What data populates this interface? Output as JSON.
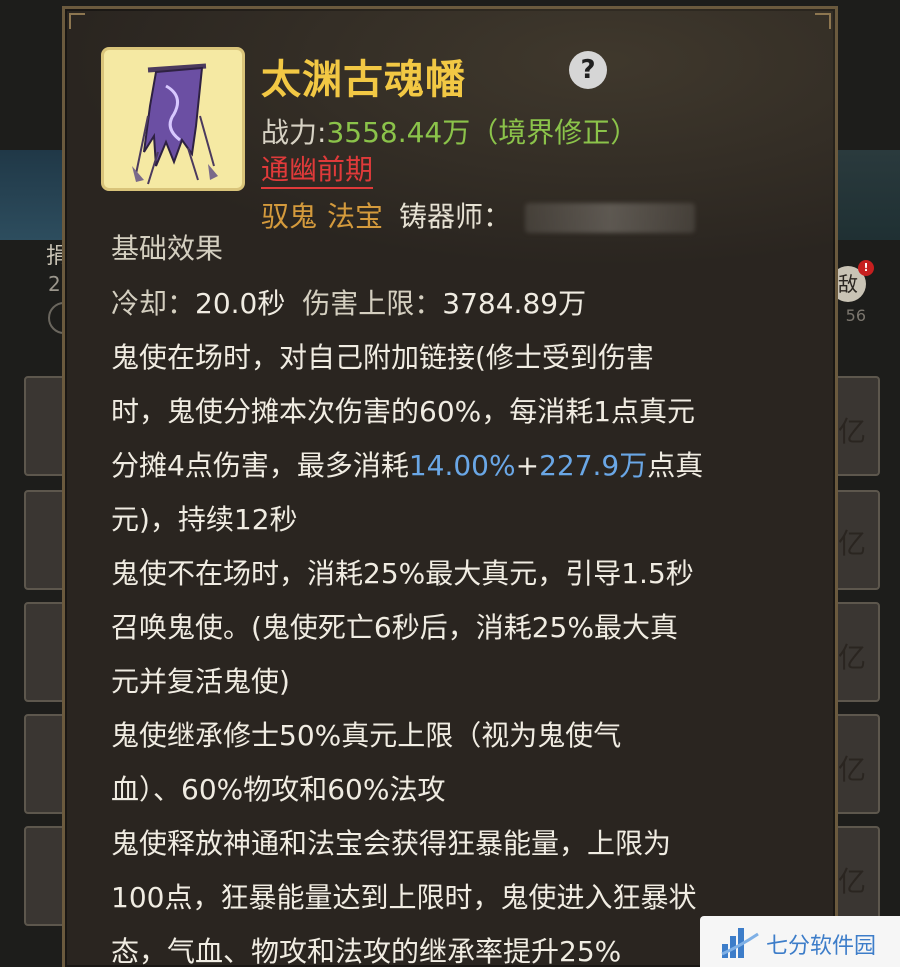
{
  "background": {
    "left_text": "捐",
    "left_num": "2",
    "right_badge": "敌",
    "right_badge_dot": "!",
    "right_num": "56",
    "right_labels": [
      "亿",
      "亿",
      "亿",
      "亿",
      "亿"
    ]
  },
  "item": {
    "icon": "banner-flag-icon",
    "name": "太渊古魂幡",
    "help_icon": "question-mark-icon",
    "power_label": "战力:",
    "power_value": "3558.44万",
    "power_note": "（境界修正）",
    "realm": "通幽前期",
    "tag_1": "驭鬼",
    "tag_2": "法宝",
    "smith_label": "铸器师："
  },
  "effects": {
    "title": "基础效果",
    "cooldown_label": "冷却：",
    "cooldown_value": "20.0秒",
    "damage_cap_label": "伤害上限：",
    "damage_cap_value": "3784.89万",
    "lines": {
      "l1": "鬼使在场时，对自己附加链接(修士受到伤害",
      "l2": "时，鬼使分摊本次伤害的60%，每消耗1点真元",
      "l3_pre": "分摊4点伤害，最多消耗",
      "l3_hl1": "14.00%",
      "l3_plus": "+",
      "l3_hl2": "227.9万",
      "l3_post": "点真",
      "l4": "元)，持续12秒",
      "l5": "鬼使不在场时，消耗25%最大真元，引导1.5秒",
      "l6": "召唤鬼使。(鬼使死亡6秒后，消耗25%最大真",
      "l7": "元并复活鬼使)",
      "l8": "鬼使继承修士50%真元上限（视为鬼使气",
      "l9": "血）、60%物攻和60%法攻",
      "l10": "鬼使释放神通和法宝会获得狂暴能量，上限为",
      "l11": "100点，狂暴能量达到上限时，鬼使进入狂暴状",
      "l12": "态，气血、物攻和法攻的继承率提升25%"
    }
  },
  "watermark": {
    "text": "七分软件园",
    "icon": "building-logo-icon"
  },
  "colors": {
    "title": "#f2c844",
    "power_value": "#8bc34a",
    "realm": "#e03a3a",
    "tag": "#d49a3c",
    "highlight": "#6aa7e6"
  }
}
